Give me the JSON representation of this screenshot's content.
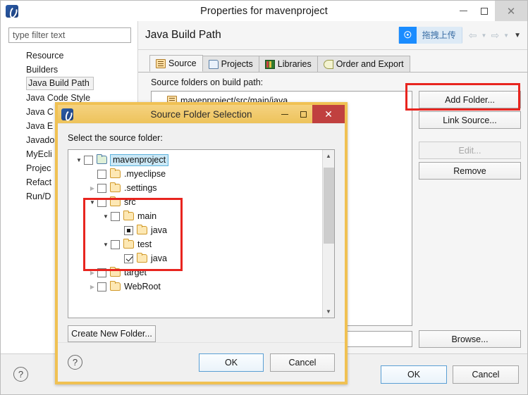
{
  "main_window": {
    "title": "Properties for mavenproject",
    "app_icon": "myeclipse-icon",
    "controls": {
      "minimize": "minimize-icon",
      "maximize": "maximize-icon",
      "close": "✕"
    },
    "filter": {
      "placeholder": "type filter text",
      "value": "type filter text"
    },
    "nav_items": [
      {
        "label": "Resource",
        "selected": false
      },
      {
        "label": "Builders",
        "selected": false
      },
      {
        "label": "Java Build Path",
        "selected": true
      },
      {
        "label": "Java Code Style",
        "selected": false
      },
      {
        "label": "Java C",
        "selected": false
      },
      {
        "label": "Java E",
        "selected": false
      },
      {
        "label": "Javado",
        "selected": false
      },
      {
        "label": "MyEcli",
        "selected": false
      },
      {
        "label": "Projec",
        "selected": false
      },
      {
        "label": "Refact",
        "selected": false
      },
      {
        "label": "Run/D",
        "selected": false
      }
    ],
    "page_title": "Java Build Path",
    "toolbar": {
      "upload_label": "拖拽上传",
      "upload_icon": "cloud-upload-icon",
      "back_icon": "back-arrow-icon",
      "forward_icon": "forward-arrow-icon",
      "dropdown_icon": "chevron-down-icon"
    },
    "tabs": [
      {
        "label": "Source",
        "icon": "source-folder-icon",
        "active": true
      },
      {
        "label": "Projects",
        "icon": "projects-icon",
        "active": false
      },
      {
        "label": "Libraries",
        "icon": "libraries-icon",
        "active": false
      },
      {
        "label": "Order and Export",
        "icon": "order-export-icon",
        "active": false
      }
    ],
    "section_label": "Source folders on build path:",
    "source_folders": [
      {
        "label": "mavenproject/src/main/java",
        "icon": "source-folder-icon"
      }
    ],
    "side_buttons": [
      {
        "label": "Add Folder...",
        "disabled": false,
        "highlighted": true
      },
      {
        "label": "Link Source...",
        "disabled": false,
        "highlighted": false
      },
      {
        "label": "Edit...",
        "disabled": true,
        "highlighted": false
      },
      {
        "label": "Remove",
        "disabled": false,
        "highlighted": false
      }
    ],
    "browse_button": "Browse...",
    "output_value": "",
    "help_icon": "help-icon",
    "footer_buttons": [
      {
        "label": "OK",
        "primary": true
      },
      {
        "label": "Cancel",
        "primary": false
      }
    ]
  },
  "dialog": {
    "title": "Source Folder Selection",
    "app_icon": "myeclipse-icon",
    "controls": {
      "minimize": "minimize-icon",
      "maximize": "maximize-icon",
      "close": "✕"
    },
    "prompt": "Select the source folder:",
    "tree": [
      {
        "label": "mavenproject",
        "depth": 0,
        "twisty": "open",
        "check": "unchecked",
        "icon": "project-folder-icon",
        "selected": true
      },
      {
        "label": ".myeclipse",
        "depth": 1,
        "twisty": "none",
        "check": "unchecked",
        "icon": "folder-icon",
        "selected": false
      },
      {
        "label": ".settings",
        "depth": 1,
        "twisty": "closed",
        "check": "unchecked",
        "icon": "folder-icon",
        "selected": false
      },
      {
        "label": "src",
        "depth": 1,
        "twisty": "open",
        "check": "unchecked",
        "icon": "folder-icon",
        "selected": false
      },
      {
        "label": "main",
        "depth": 2,
        "twisty": "open",
        "check": "unchecked",
        "icon": "folder-icon",
        "selected": false
      },
      {
        "label": "java",
        "depth": 3,
        "twisty": "none",
        "check": "partial",
        "icon": "folder-icon",
        "selected": false
      },
      {
        "label": "test",
        "depth": 2,
        "twisty": "open",
        "check": "unchecked",
        "icon": "folder-icon",
        "selected": false
      },
      {
        "label": "java",
        "depth": 3,
        "twisty": "none",
        "check": "checked",
        "icon": "folder-icon",
        "selected": false
      },
      {
        "label": "target",
        "depth": 1,
        "twisty": "closed",
        "check": "unchecked",
        "icon": "folder-icon",
        "selected": false
      },
      {
        "label": "WebRoot",
        "depth": 1,
        "twisty": "closed",
        "check": "unchecked",
        "icon": "folder-icon",
        "selected": false
      }
    ],
    "create_button": "Create New Folder...",
    "help_icon": "help-icon",
    "footer_buttons": [
      {
        "label": "OK",
        "primary": true
      },
      {
        "label": "Cancel",
        "primary": false
      }
    ]
  },
  "annotations": {
    "highlight_color": "#e8251f",
    "boxes": [
      {
        "name": "add-folder-highlight"
      },
      {
        "name": "src-tree-highlight"
      }
    ]
  }
}
